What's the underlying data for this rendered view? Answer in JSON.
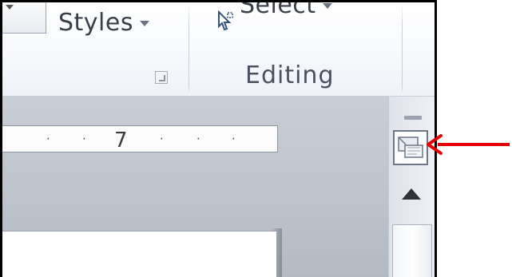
{
  "ribbon": {
    "styles": {
      "label": "Styles",
      "dropdown_icon": "chevron-down-icon"
    },
    "editing": {
      "select_label": "Select",
      "select_icon": "select-cursor-icon",
      "group_label": "Editing"
    },
    "launcher_icon": "dialog-launcher-icon"
  },
  "ruler": {
    "label": "7"
  },
  "scrollbar": {
    "ruler_toggle_icon": "view-ruler-icon",
    "up_icon": "scroll-up-icon"
  },
  "annotation": {
    "arrow_color": "#e60000"
  }
}
